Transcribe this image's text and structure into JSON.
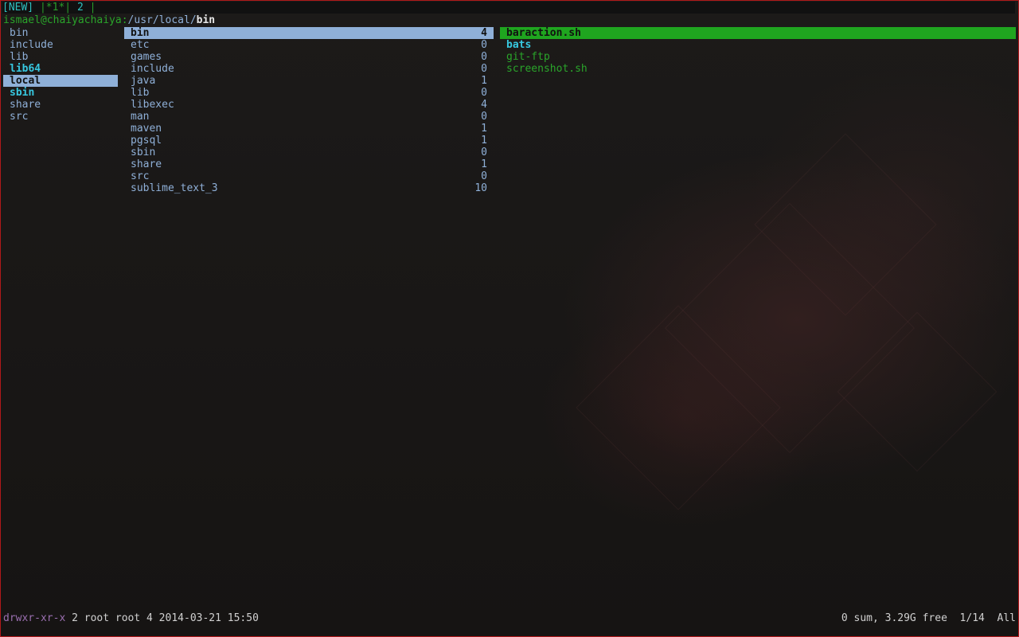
{
  "tabbar": {
    "new_label": "[NEW]",
    "separator": "|",
    "active_tab": "*1*",
    "inactive_tab": "2"
  },
  "path": {
    "host": "ismael@chaiyachaiya:",
    "parent": "/usr/local/",
    "current": "bin"
  },
  "parent_column": {
    "items": [
      {
        "name": "bin",
        "kind": "dir"
      },
      {
        "name": "include",
        "kind": "dir"
      },
      {
        "name": "lib",
        "kind": "dir"
      },
      {
        "name": "lib64",
        "kind": "link"
      },
      {
        "name": "local",
        "kind": "selected"
      },
      {
        "name": "sbin",
        "kind": "link"
      },
      {
        "name": "share",
        "kind": "dir"
      },
      {
        "name": "src",
        "kind": "dir"
      }
    ]
  },
  "current_column": {
    "items": [
      {
        "name": "bin",
        "count": "4"
      },
      {
        "name": "etc",
        "count": "0"
      },
      {
        "name": "games",
        "count": "0"
      },
      {
        "name": "include",
        "count": "0"
      },
      {
        "name": "java",
        "count": "1"
      },
      {
        "name": "lib",
        "count": "0"
      },
      {
        "name": "libexec",
        "count": "4"
      },
      {
        "name": "man",
        "count": "0"
      },
      {
        "name": "maven",
        "count": "1"
      },
      {
        "name": "pgsql",
        "count": "1"
      },
      {
        "name": "sbin",
        "count": "0"
      },
      {
        "name": "share",
        "count": "1"
      },
      {
        "name": "src",
        "count": "0"
      },
      {
        "name": "sublime_text_3",
        "count": "10"
      }
    ]
  },
  "preview_column": {
    "items": [
      {
        "name": "baraction.sh",
        "kind": "selected"
      },
      {
        "name": "bats",
        "kind": "link"
      },
      {
        "name": "git-ftp",
        "kind": "exec"
      },
      {
        "name": "screenshot.sh",
        "kind": "exec"
      }
    ]
  },
  "statusbar": {
    "permissions": "drwxr-xr-x",
    "info": " 2 root root 4 2014-03-21 15:50",
    "summary": "0 sum, 3.29G free  1/14  All"
  },
  "colors": {
    "border": "#b0191a",
    "selection_blue": "#8fb0d8",
    "selection_green": "#1fa51f",
    "directory": "#8fb0d8",
    "link": "#37c8e0",
    "executable": "#2aa52a",
    "permissions": "#9a6fb0"
  }
}
